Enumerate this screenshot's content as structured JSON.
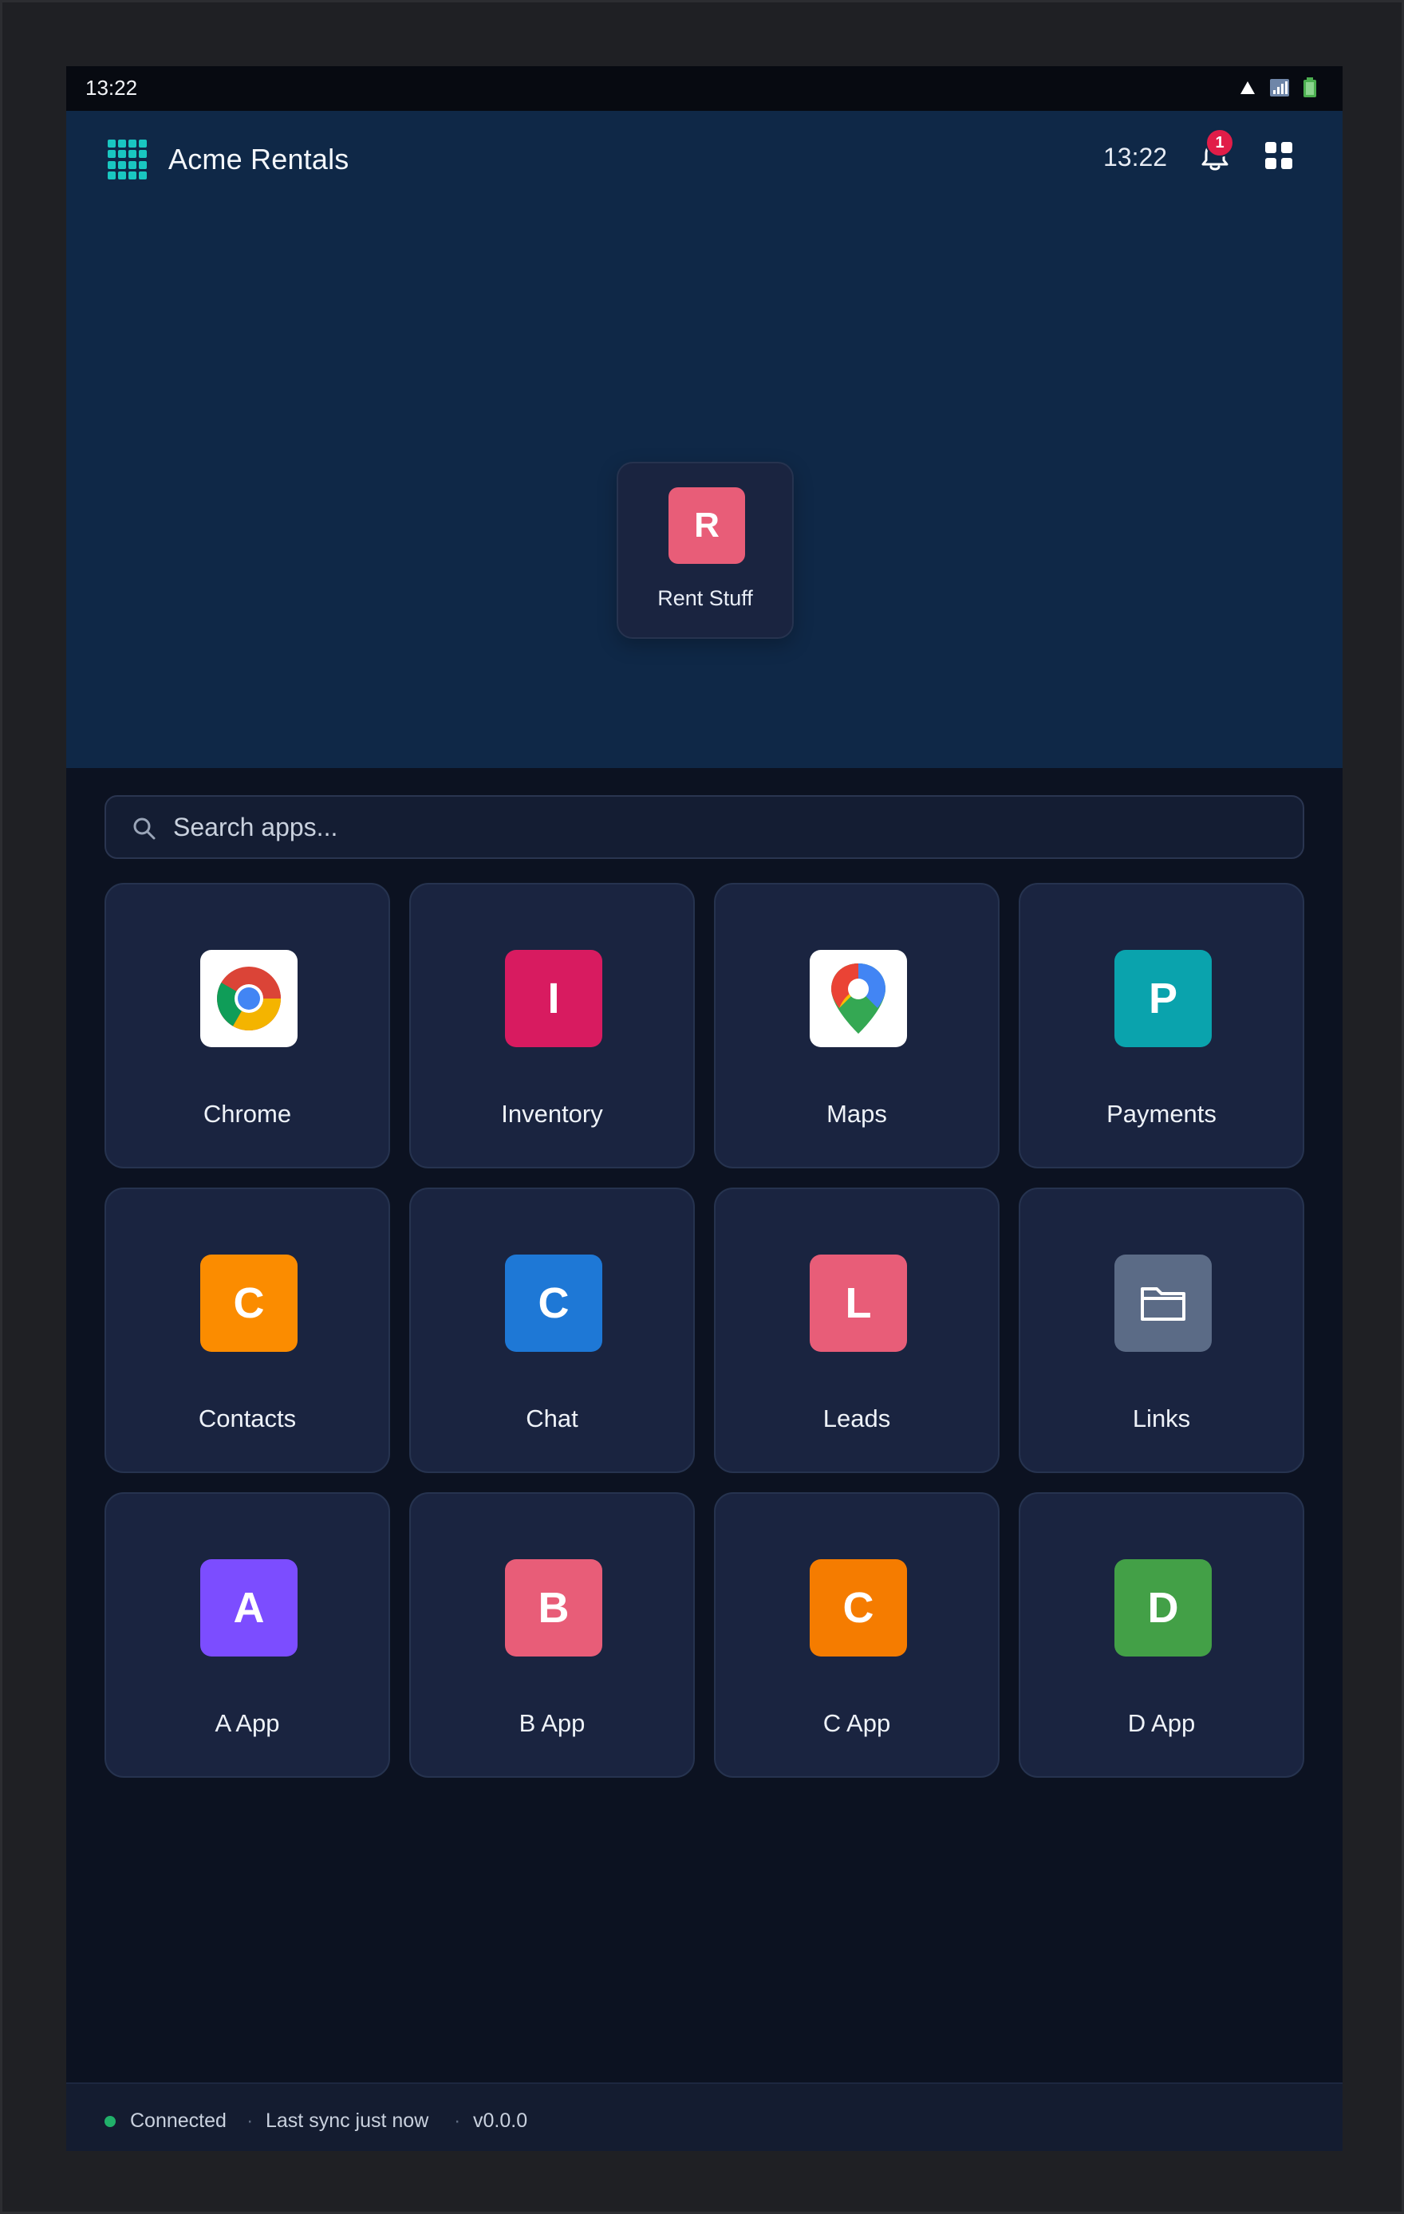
{
  "status_bar": {
    "time": "13:22"
  },
  "header": {
    "app_icon": "app-grid-icon",
    "title": "Acme Rentals",
    "time": "13:22",
    "notifications_icon": "bell-icon",
    "notifications_count": "1",
    "apps_icon": "four-squares-icon"
  },
  "pinned": {
    "icon_letter": "R",
    "label": "Rent Stuff",
    "color": "#e85d78"
  },
  "search": {
    "placeholder": "Search apps..."
  },
  "apps": [
    {
      "label": "Chrome",
      "icon": "chrome-icon",
      "letter": "",
      "color": "#ffffff"
    },
    {
      "label": "Inventory",
      "icon": "letter-icon",
      "letter": "I",
      "color": "#d81b60"
    },
    {
      "label": "Maps",
      "icon": "maps-pin-icon",
      "letter": "",
      "color": "#ffffff"
    },
    {
      "label": "Payments",
      "icon": "letter-icon",
      "letter": "P",
      "color": "#0aa3ad"
    },
    {
      "label": "Contacts",
      "icon": "letter-icon",
      "letter": "C",
      "color": "#fb8c00"
    },
    {
      "label": "Chat",
      "icon": "letter-icon",
      "letter": "C",
      "color": "#1e78d6"
    },
    {
      "label": "Leads",
      "icon": "letter-icon",
      "letter": "L",
      "color": "#e85d78"
    },
    {
      "label": "Links",
      "icon": "folder-icon",
      "letter": "",
      "color": "#5b6b86"
    },
    {
      "label": "A App",
      "icon": "letter-icon",
      "letter": "A",
      "color": "#7c4dff"
    },
    {
      "label": "B App",
      "icon": "letter-icon",
      "letter": "B",
      "color": "#e85d78"
    },
    {
      "label": "C App",
      "icon": "letter-icon",
      "letter": "C",
      "color": "#f57c00"
    },
    {
      "label": "D App",
      "icon": "letter-icon",
      "letter": "D",
      "color": "#43a047"
    }
  ],
  "footer": {
    "status": "Connected",
    "status_color": "#21b06a",
    "separator": "·",
    "sync": "Last sync just now",
    "version": "v0.0.0"
  }
}
